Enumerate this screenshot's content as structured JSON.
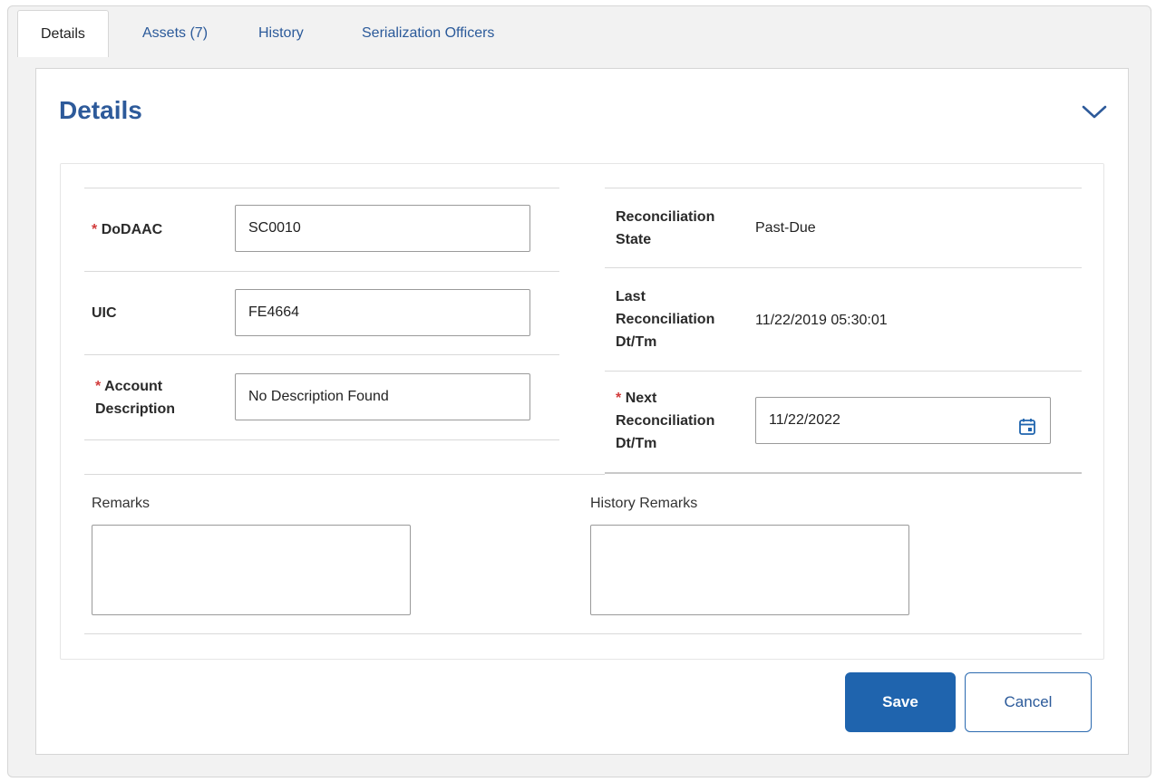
{
  "tabs": [
    {
      "label": "Details"
    },
    {
      "label": "Assets (7)"
    },
    {
      "label": "History"
    },
    {
      "label": "Serialization Officers"
    }
  ],
  "panel": {
    "title": "Details"
  },
  "form": {
    "dodaac": {
      "label": "DoDAAC",
      "required": "*",
      "value": "SC0010"
    },
    "uic": {
      "label": "UIC",
      "value": "FE4664"
    },
    "account_description": {
      "label_line1": "Account",
      "label_line2": "Description",
      "required": "*",
      "value": "No Description Found"
    },
    "reconciliation_state": {
      "label_line1": "Reconciliation",
      "label_line2": "State",
      "value": "Past-Due"
    },
    "last_reconciliation": {
      "label_line1": "Last",
      "label_line2": "Reconciliation",
      "label_line3": "Dt/Tm",
      "value": "11/22/2019 05:30:01"
    },
    "next_reconciliation": {
      "label_line1": "Next",
      "label_line2": "Reconciliation",
      "label_line3": "Dt/Tm",
      "required": "*",
      "value": "11/22/2022"
    },
    "remarks": {
      "label": "Remarks",
      "value": ""
    },
    "history_remarks": {
      "label": "History Remarks",
      "value": ""
    }
  },
  "buttons": {
    "save": "Save",
    "cancel": "Cancel"
  },
  "colors": {
    "accent": "#1f64ae",
    "title": "#2d5a9a",
    "required": "#d23b3b"
  },
  "icons": {
    "collapse": "chevron-down-icon",
    "calendar": "calendar-icon"
  }
}
